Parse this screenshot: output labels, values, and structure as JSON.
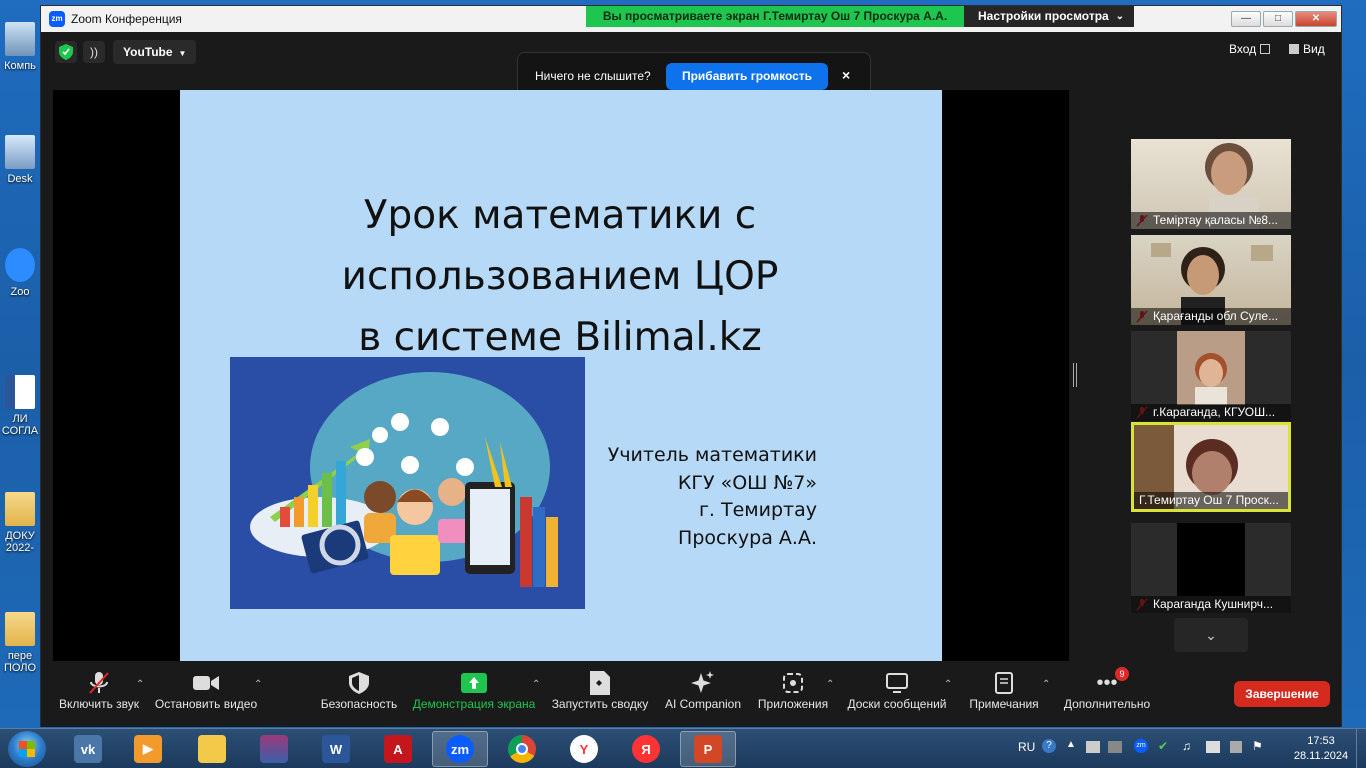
{
  "desktop": {
    "icons": [
      {
        "label": "Компь",
        "kind": "computer"
      },
      {
        "label": "Desk",
        "kind": "desktop"
      },
      {
        "label": "Zoo",
        "kind": "zoom"
      },
      {
        "label": "ЛИ",
        "label2": "СОГЛА",
        "kind": "word"
      },
      {
        "label": "ДОКУ",
        "label2": "2022-",
        "kind": "folder"
      },
      {
        "label": "пере",
        "label2": "ПОЛО",
        "kind": "folder"
      }
    ]
  },
  "window": {
    "logo": "zm",
    "title": "Zoom Конференция",
    "share_banner": "Вы просматриваете экран Г.Темиртау Ош 7 Проскура А.А.",
    "view_options": "Настройки просмотра"
  },
  "topbar": {
    "stream": "YouTube",
    "enter": "Вход",
    "view": "Вид"
  },
  "notice": {
    "text": "Ничего не слышите?",
    "button": "Прибавить громкость",
    "close": "×"
  },
  "slide": {
    "title_line1": "Урок математики с",
    "title_line2": "использованием ЦОР",
    "title_line3": "в системе Bilimal.kz",
    "author_line1": "Учитель математики",
    "author_line2": "КГУ «ОШ №7»",
    "author_line3": "г. Темиртау",
    "author_line4": "Проскура А.А."
  },
  "participants": [
    {
      "name": "Теміртау қаласы №8...",
      "muted": true,
      "active": false
    },
    {
      "name": "Қарағанды обл Суле...",
      "muted": true,
      "active": false
    },
    {
      "name": "г.Караганда, КГУОШ...",
      "muted": true,
      "active": false
    },
    {
      "name": "Г.Темиртау Ош 7 Проск...",
      "muted": false,
      "active": true
    },
    {
      "name": "Караганда Кушнирч...",
      "muted": true,
      "active": false
    }
  ],
  "toolbar": {
    "audio": "Включить звук",
    "video": "Остановить видео",
    "security": "Безопасность",
    "share": "Демонстрация экрана",
    "summary": "Запустить сводку",
    "ai": "AI Companion",
    "apps": "Приложения",
    "whiteboards": "Доски сообщений",
    "notes": "Примечания",
    "more": "Дополнительно",
    "more_badge": "9",
    "end": "Завершение"
  },
  "taskbar": {
    "lang": "RU",
    "time": "17:53",
    "date": "28.11.2024",
    "apps": [
      "vk",
      "media-player",
      "file-explorer",
      "winrar",
      "word",
      "pdf-reader",
      "zoom",
      "chrome",
      "yandex-browser",
      "yandex",
      "powerpoint"
    ]
  },
  "colors": {
    "zoom_blue": "#0b5cff",
    "share_green": "#1ec64f",
    "end_red": "#d52b1e",
    "slide_bg": "#b6d9f7",
    "active_border": "#d9e536"
  }
}
